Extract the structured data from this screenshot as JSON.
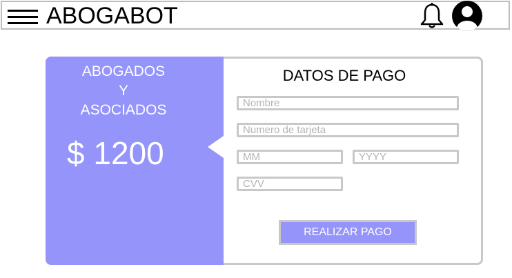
{
  "header": {
    "title": "ABOGABOT",
    "menu_icon": "hamburger-menu-icon",
    "notification_icon": "bell-icon",
    "profile_icon": "user-avatar-icon"
  },
  "summary": {
    "firm_name": "ABOGADOS\nY\nASOCIADOS",
    "price": "$ 1200",
    "background_color": "#9494fb"
  },
  "payment_form": {
    "title": "DATOS DE PAGO",
    "name_placeholder": "Nombre",
    "card_number_placeholder": "Numero de tarjeta",
    "month_placeholder": "MM",
    "year_placeholder": "YYYY",
    "cvv_placeholder": "CVV",
    "submit_label": "REALIZAR PAGO"
  }
}
